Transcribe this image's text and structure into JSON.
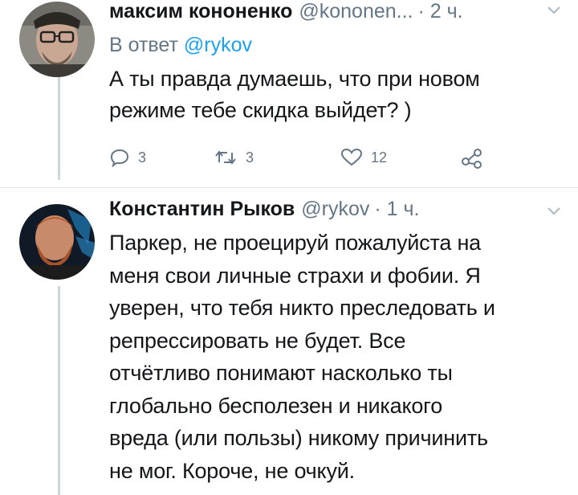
{
  "tweets": [
    {
      "name": "максим кононенко",
      "handle": "@kononen...",
      "time": "· 2 ч.",
      "reply_prefix": "В ответ",
      "reply_handle": "@rykov",
      "text_lines": [
        "А ты правда думаешь, что при новом",
        "режиме тебе скидка выйдет? )"
      ],
      "actions": {
        "replies": "3",
        "retweets": "3",
        "likes": "12"
      }
    },
    {
      "name": "Константин Рыков",
      "handle": "@rykov",
      "time": "· 1 ч.",
      "text_lines": [
        "Паркер, не проецируй пожалуйста на",
        "меня свои личные страхи и фобии. Я",
        "уверен, что тебя никто преследовать и",
        "репрессировать не будет. Все",
        "отчётливо понимают насколько ты",
        "глобально бесполезен и никакого",
        "вреда (или пользы) никому причинить",
        "не мог. Короче, не очкуй."
      ]
    }
  ],
  "icons": {
    "reply": "reply-icon",
    "retweet": "retweet-icon",
    "like": "heart-icon",
    "share": "share-icon",
    "caret": "chevron-down-icon"
  },
  "colors": {
    "link": "#1da1f2",
    "muted": "#657786",
    "text": "#14171a",
    "thread_line": "#ccd6dd"
  }
}
